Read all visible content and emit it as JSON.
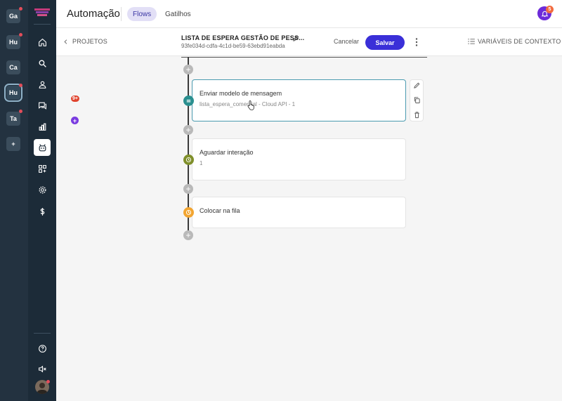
{
  "workspaces": [
    {
      "label": "Ga",
      "dot": true
    },
    {
      "label": "Hu",
      "dot": true
    },
    {
      "label": "Ca",
      "dot": false
    },
    {
      "label": "Hu",
      "dot": true,
      "active": true
    },
    {
      "label": "Ta",
      "dot": true
    },
    {
      "label": "+",
      "dot": false
    }
  ],
  "nav": {
    "chat_badge": "9+",
    "reports_badge": "+"
  },
  "header": {
    "title": "Automação",
    "tabs": [
      {
        "label": "Flows",
        "active": true
      },
      {
        "label": "Gatilhos",
        "active": false
      }
    ],
    "notification_count": "5"
  },
  "subheader": {
    "back_label": "PROJETOS",
    "flow_name": "LISTA DE ESPERA GESTÃO DE PESS...",
    "flow_id": "93fe034d-cdfa-4c1d-be59-63ebd91eabda",
    "cancel_label": "Cancelar",
    "save_label": "Salvar",
    "context_label": "VARIÁVEIS DE CONTEXTO"
  },
  "nodes": [
    {
      "title": "Enviar modelo de mensagem",
      "subtitle": "lista_espera_comercial - Cloud API - 1",
      "icon": "message-icon",
      "color": "#2a8f8f"
    },
    {
      "title": "Aguardar interação",
      "subtitle": "1",
      "icon": "clock-icon",
      "color": "#7f8f2a"
    },
    {
      "title": "Colocar na fila",
      "subtitle": "",
      "icon": "queue-icon",
      "color": "#f2a531"
    }
  ],
  "colors": {
    "accent": "#3a2fd8",
    "tab_active_bg": "#e2dff6",
    "sidebar": "#1c2b38"
  }
}
